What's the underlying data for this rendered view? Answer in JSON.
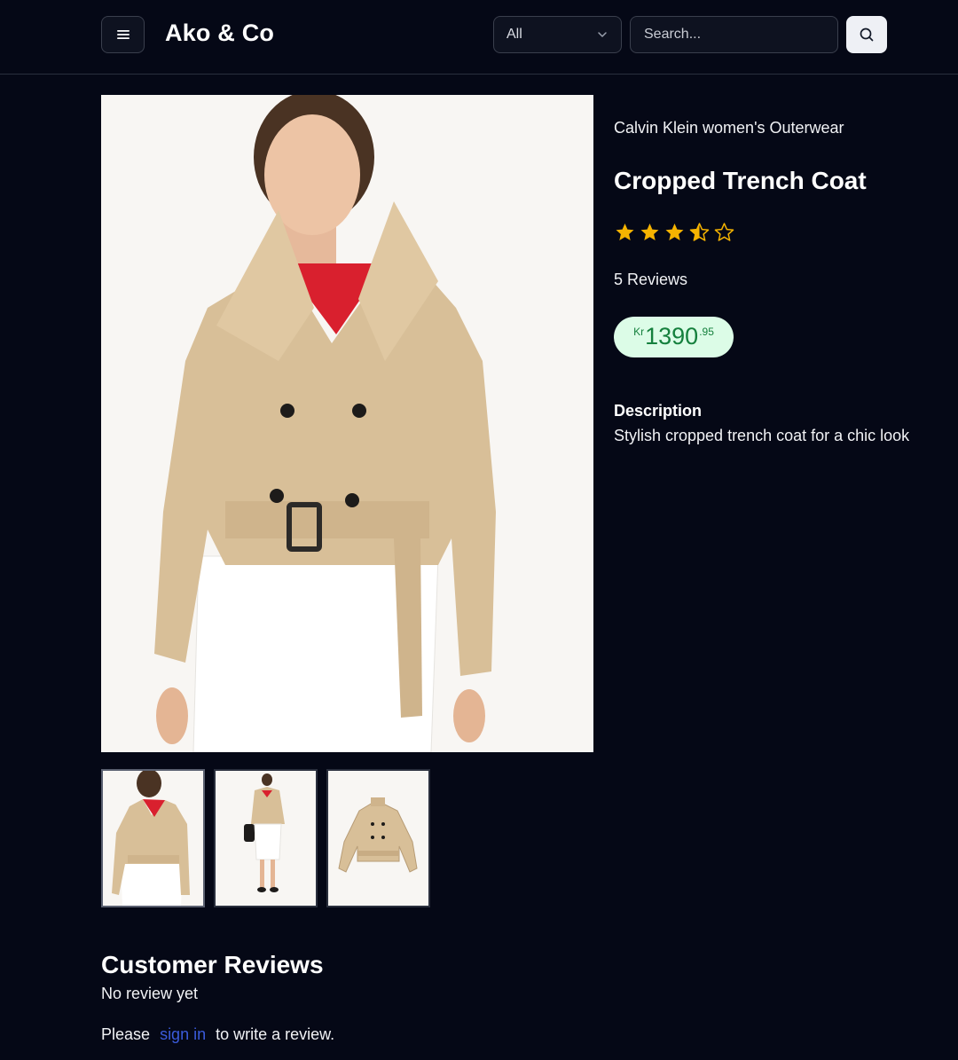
{
  "header": {
    "brand": "Ako & Co",
    "category_selected": "All",
    "search_placeholder": "Search..."
  },
  "product": {
    "brand_line": "Calvin Klein women's Outerwear",
    "title": "Cropped Trench Coat",
    "rating": 3.5,
    "rating_max": 5,
    "reviews_count_label": "5 Reviews",
    "price": {
      "currency": "Kr",
      "whole": "1390",
      "decimal": ".95"
    },
    "description_label": "Description",
    "description": "Stylish cropped trench coat for a chic look",
    "thumbnail_count": 3
  },
  "reviews": {
    "title": "Customer Reviews",
    "empty_text": "No review yet",
    "signin_prefix": "Please",
    "signin_link": "sign in",
    "signin_suffix": "to write a review."
  },
  "colors": {
    "background": "#050816",
    "star": "#f5b301",
    "price_bg": "#dcfce7",
    "price_text": "#15803d",
    "link": "#3b5bdb"
  }
}
